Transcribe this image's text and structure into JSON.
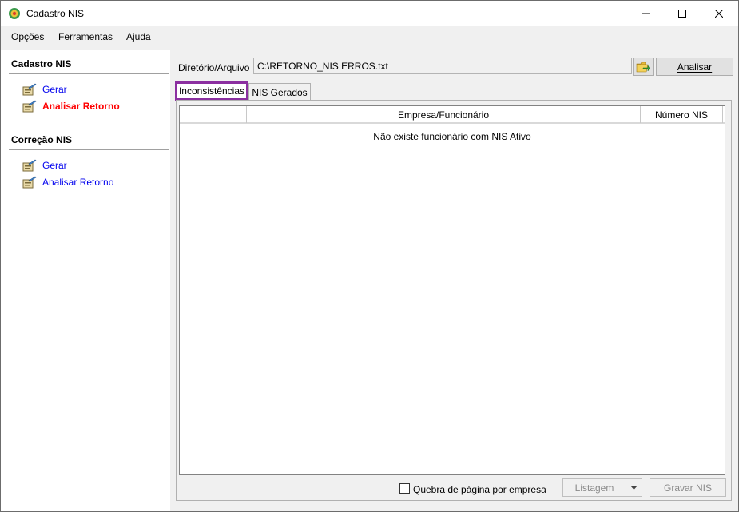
{
  "window": {
    "title": "Cadastro NIS",
    "icon": "app-globe-icon"
  },
  "menu": {
    "items": [
      {
        "label": "Opções"
      },
      {
        "label": "Ferramentas"
      },
      {
        "label": "Ajuda"
      }
    ]
  },
  "sidebar": {
    "sections": [
      {
        "title": "Cadastro NIS",
        "links": [
          {
            "label": "Gerar",
            "state": "normal"
          },
          {
            "label": "Analisar Retorno",
            "state": "active"
          }
        ]
      },
      {
        "title": "Correção NIS",
        "links": [
          {
            "label": "Gerar",
            "state": "normal"
          },
          {
            "label": "Analisar Retorno",
            "state": "normal"
          }
        ]
      }
    ]
  },
  "file": {
    "label": "Diretório/Arquivo",
    "value": "C:\\RETORNO_NIS ERROS.txt",
    "folder_icon": "open-folder-icon",
    "analyze_label": "Analisar"
  },
  "tabs": [
    {
      "label": "Inconsistências",
      "selected": true
    },
    {
      "label": "NIS Gerados",
      "selected": false
    }
  ],
  "grid": {
    "columns": [
      "",
      "Empresa/Funcionário",
      "Número NIS"
    ],
    "empty_message": "Não existe funcionário com NIS Ativo"
  },
  "footer": {
    "checkbox_label": "Quebra de página por empresa",
    "checkbox_checked": false,
    "listagem_label": "Listagem",
    "gravar_label": "Gravar NIS"
  },
  "colors": {
    "link": "#0000ee",
    "active_link": "#ff0000",
    "tab_highlight": "#8b2fa0"
  }
}
